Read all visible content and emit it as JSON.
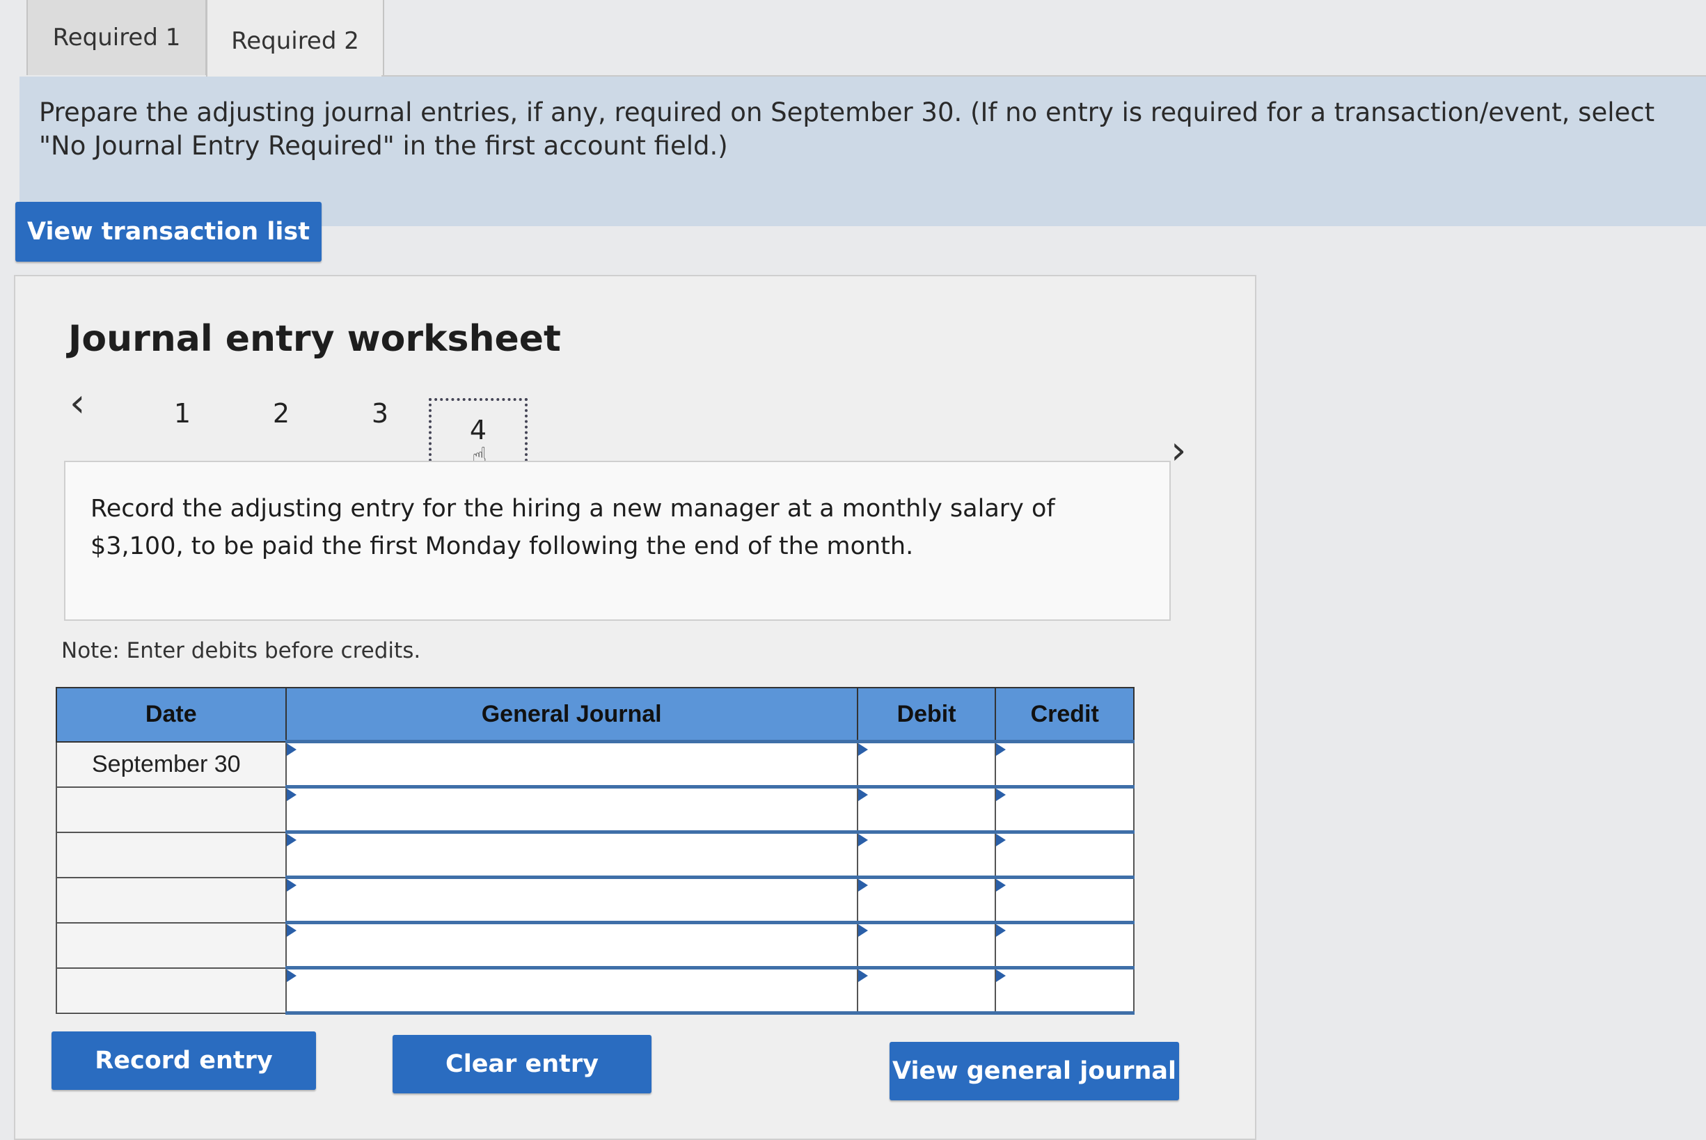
{
  "tabs": [
    {
      "label": "Required 1"
    },
    {
      "label": "Required 2"
    }
  ],
  "instructions": "Prepare the adjusting journal entries, if any, required on September 30. (If no entry is required for a transaction/event, select \"No Journal Entry Required\" in the first account field.)",
  "view_transaction_list_label": "View transaction list",
  "worksheet": {
    "title": "Journal entry worksheet",
    "steps": [
      "1",
      "2",
      "3",
      "4"
    ],
    "active_step": "4",
    "description": "Record the adjusting entry for the hiring a new manager at a monthly salary of $3,100, to be paid the first Monday following the end of the month.",
    "note": "Note: Enter debits before credits.",
    "table": {
      "headers": {
        "date": "Date",
        "general_journal": "General Journal",
        "debit": "Debit",
        "credit": "Credit"
      },
      "rows": [
        {
          "date": "September 30",
          "account": "",
          "debit": "",
          "credit": ""
        },
        {
          "date": "",
          "account": "",
          "debit": "",
          "credit": ""
        },
        {
          "date": "",
          "account": "",
          "debit": "",
          "credit": ""
        },
        {
          "date": "",
          "account": "",
          "debit": "",
          "credit": ""
        },
        {
          "date": "",
          "account": "",
          "debit": "",
          "credit": ""
        },
        {
          "date": "",
          "account": "",
          "debit": "",
          "credit": ""
        }
      ]
    },
    "buttons": {
      "record": "Record entry",
      "clear": "Clear entry",
      "view_general_journal": "View general journal"
    }
  },
  "icons": {
    "prev": "chevron-left-icon",
    "next": "chevron-right-icon",
    "cursor": "hand-pointer-icon"
  },
  "colors": {
    "accent": "#2a6cc0",
    "header_blue": "#5b95d8",
    "instruction_bg": "#cdd9e6"
  }
}
